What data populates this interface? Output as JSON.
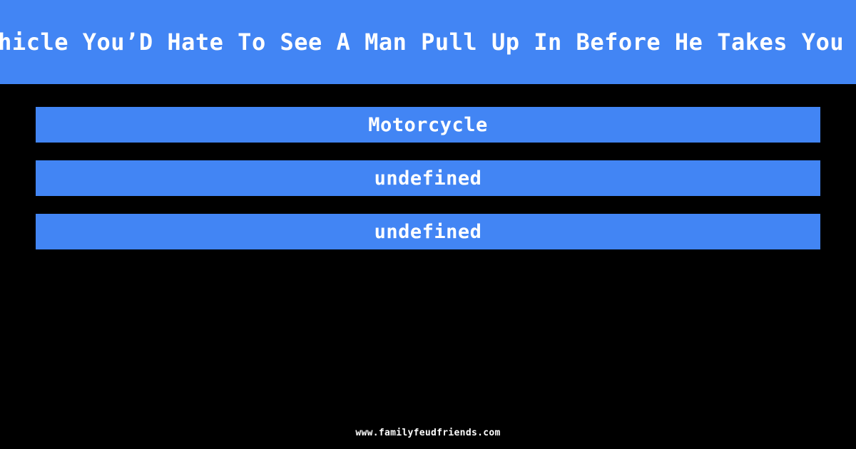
{
  "theme": {
    "background": "#000000",
    "accent": "#4285f4",
    "text": "#ffffff"
  },
  "question": {
    "text": "Name A Vehicle You’D Hate To See A Man Pull Up In Before He Takes You On A Date"
  },
  "answers": [
    {
      "label": "Motorcycle"
    },
    {
      "label": "undefined"
    },
    {
      "label": "undefined"
    }
  ],
  "footer": {
    "site": "www.familyfeudfriends.com"
  }
}
